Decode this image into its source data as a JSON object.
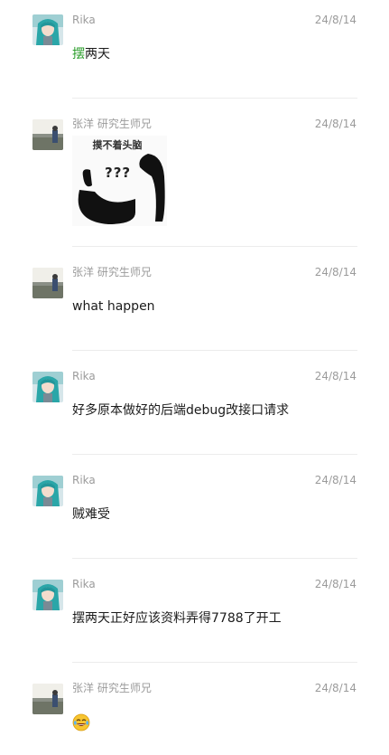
{
  "messages": [
    {
      "sender": "Rika",
      "time": "24/8/14",
      "text_highlight": "摆",
      "text_rest": "两天"
    },
    {
      "sender": "张洋 研究生师兄",
      "time": "24/8/14",
      "sticker_caption": "摸不着头脑",
      "sticker_marks": "???"
    },
    {
      "sender": "张洋 研究生师兄",
      "time": "24/8/14",
      "text": "what happen"
    },
    {
      "sender": "Rika",
      "time": "24/8/14",
      "text": "好多原本做好的后端debug改接口请求"
    },
    {
      "sender": "Rika",
      "time": "24/8/14",
      "text": "贼难受"
    },
    {
      "sender": "Rika",
      "time": "24/8/14",
      "text": "摆两天正好应该资料弄得7788了开工"
    },
    {
      "sender": "张洋 研究生师兄",
      "time": "24/8/14",
      "emoji": "laughing-tears-emoji"
    }
  ],
  "colors": {
    "highlight": "#2a9d2a",
    "meta_text": "#9b9b9b",
    "divider": "#ececec"
  }
}
